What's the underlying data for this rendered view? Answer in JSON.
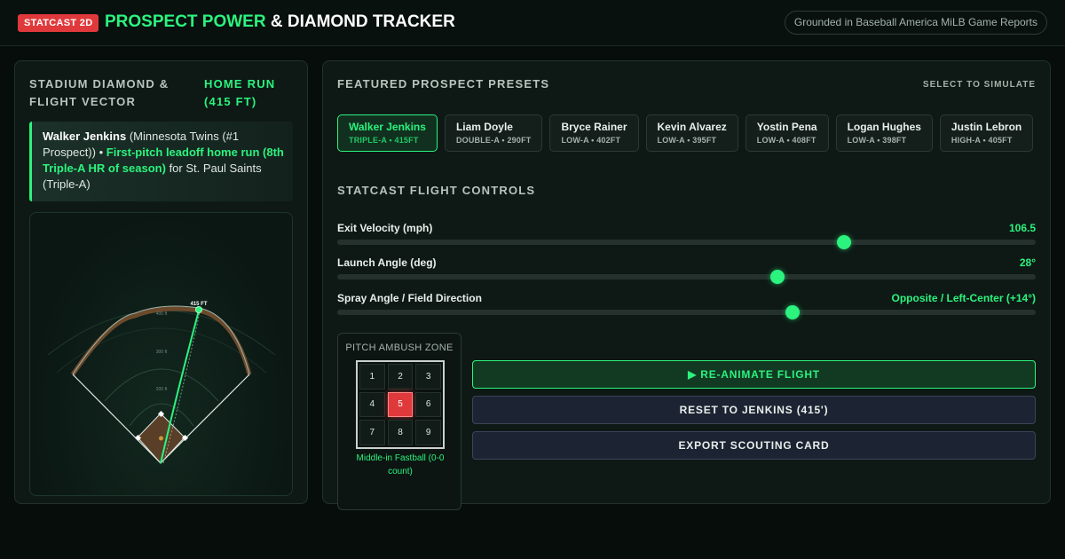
{
  "header": {
    "badge": "STATCAST 2D",
    "title_highlight": "PROSPECT POWER",
    "title_rest": "& DIAMOND TRACKER",
    "source_note": "Grounded in Baseball America MiLB Game Reports"
  },
  "left_panel": {
    "title": "STADIUM DIAMOND & FLIGHT VECTOR",
    "result": "HOME RUN (415 FT)",
    "callout": {
      "player": "Walker Jenkins",
      "team_note": "(Minnesota Twins (#1 Prospect))",
      "separator": "•",
      "highlight": "First-pitch leadoff home run (8th Triple-A HR of season)",
      "suffix": "for St. Paul Saints (Triple-A)"
    },
    "field": {
      "distance_label": "415 FT",
      "arc_labels": [
        "400 ft",
        "300 ft",
        "200 ft"
      ]
    }
  },
  "right_panel": {
    "presets_title": "FEATURED PROSPECT PRESETS",
    "select_hint": "SELECT TO SIMULATE",
    "presets": [
      {
        "name": "Walker Jenkins",
        "meta": "TRIPLE-A • 415FT",
        "active": true
      },
      {
        "name": "Liam Doyle",
        "meta": "DOUBLE-A • 290FT",
        "active": false
      },
      {
        "name": "Bryce Rainer",
        "meta": "LOW-A • 402FT",
        "active": false
      },
      {
        "name": "Kevin Alvarez",
        "meta": "LOW-A • 395FT",
        "active": false
      },
      {
        "name": "Yostin Pena",
        "meta": "LOW-A • 408FT",
        "active": false
      },
      {
        "name": "Logan Hughes",
        "meta": "LOW-A • 398FT",
        "active": false
      },
      {
        "name": "Justin Lebron",
        "meta": "HIGH-A • 405FT",
        "active": false
      }
    ],
    "controls_title": "STATCAST FLIGHT CONTROLS",
    "sliders": [
      {
        "label": "Exit Velocity (mph)",
        "value": "106.5",
        "fraction": 0.725
      },
      {
        "label": "Launch Angle (deg)",
        "value": "28°",
        "fraction": 0.63
      },
      {
        "label": "Spray Angle / Field Direction",
        "value": "Opposite / Left-Center (+14°)",
        "fraction": 0.652
      }
    ],
    "zone": {
      "title": "PITCH AMBUSH ZONE",
      "cells": [
        "1",
        "2",
        "3",
        "4",
        "5",
        "6",
        "7",
        "8",
        "9"
      ],
      "active_cell": "5",
      "caption": "Middle-in Fastball (0-0 count)"
    },
    "buttons": {
      "reanimate": "RE-ANIMATE FLIGHT",
      "reset": "RESET TO JENKINS (415')",
      "export": "EXPORT SCOUTING CARD"
    }
  },
  "colors": {
    "accent": "#2bf37e",
    "badge": "#e0393b",
    "background": "#070d0b",
    "panel": "#0e1915"
  }
}
